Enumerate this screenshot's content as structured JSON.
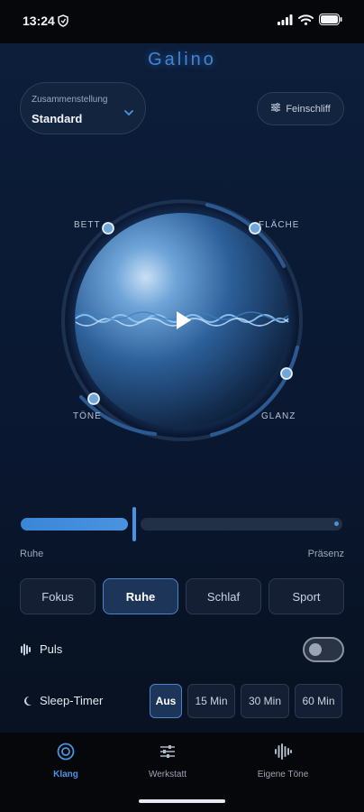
{
  "status_bar": {
    "time": "13:24"
  },
  "app": {
    "title": "Galino"
  },
  "preset": {
    "label": "Zusammenstellung",
    "value": "Standard"
  },
  "fine_tune": {
    "label": "Feinschliff"
  },
  "orb": {
    "labels": {
      "top_left": "BETT",
      "top_right": "FLÄCHE",
      "bottom_left": "TÖNE",
      "bottom_right": "GLANZ"
    }
  },
  "slider": {
    "left_label": "Ruhe",
    "right_label": "Präsenz",
    "value": 0.34
  },
  "modes": [
    {
      "label": "Fokus",
      "active": false
    },
    {
      "label": "Ruhe",
      "active": true
    },
    {
      "label": "Schlaf",
      "active": false
    },
    {
      "label": "Sport",
      "active": false
    }
  ],
  "puls": {
    "label": "Puls",
    "enabled": false
  },
  "sleep_timer": {
    "label": "Sleep-Timer",
    "options": [
      {
        "label": "Aus",
        "active": true
      },
      {
        "label": "15 Min",
        "active": false
      },
      {
        "label": "30 Min",
        "active": false
      },
      {
        "label": "60 Min",
        "active": false
      }
    ]
  },
  "nav": [
    {
      "label": "Klang",
      "icon": "target-icon",
      "active": true
    },
    {
      "label": "Werkstatt",
      "icon": "sliders-icon",
      "active": false
    },
    {
      "label": "Eigene Töne",
      "icon": "waveform-icon",
      "active": false
    }
  ],
  "colors": {
    "accent": "#4a93e0",
    "background": "#0b1b36",
    "nav_bg": "#05070b"
  }
}
